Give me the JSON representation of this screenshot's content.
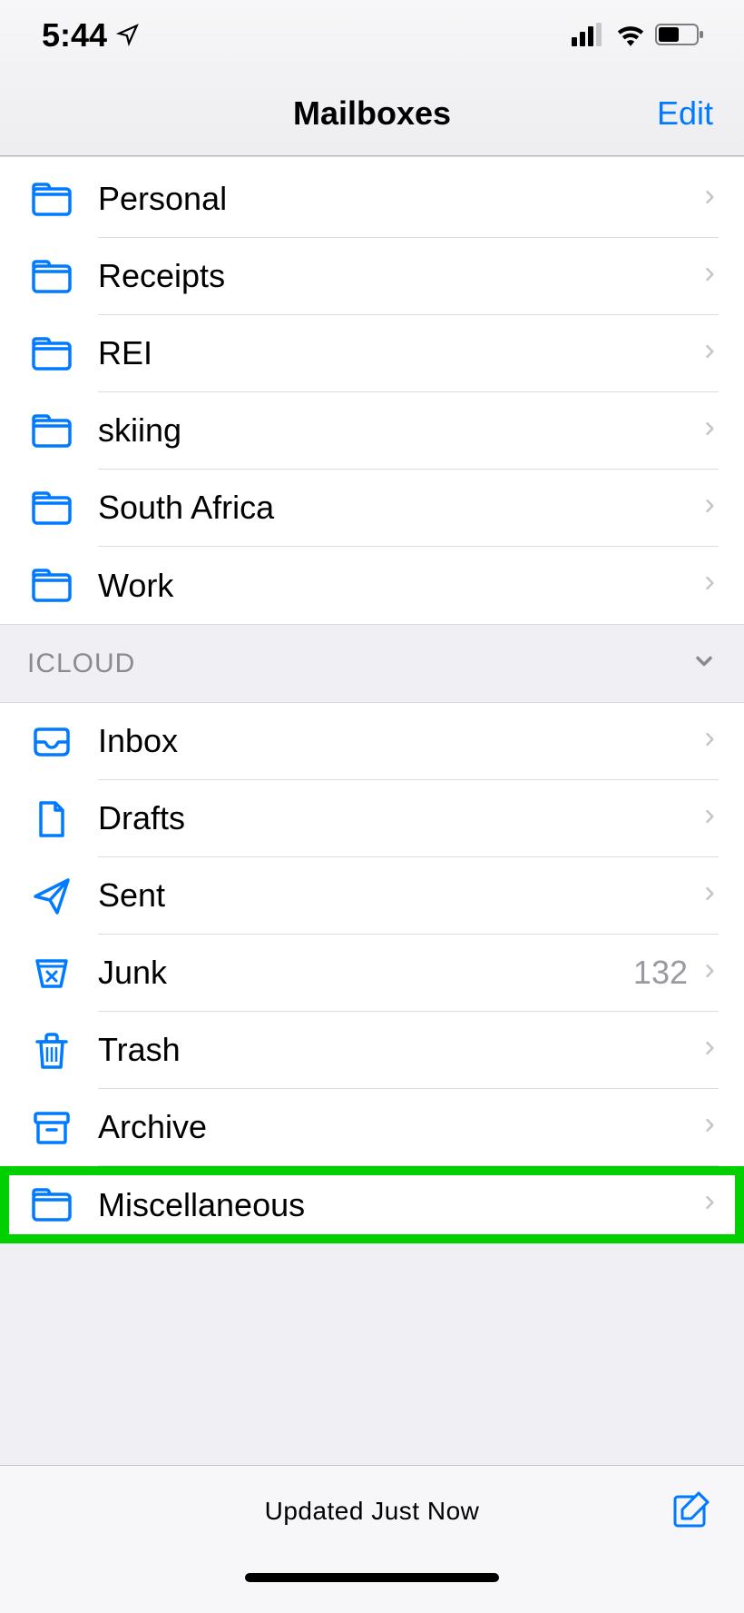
{
  "status": {
    "time": "5:44"
  },
  "header": {
    "title": "Mailboxes",
    "edit": "Edit"
  },
  "folders": [
    {
      "label": "Personal",
      "icon": "folder"
    },
    {
      "label": "Receipts",
      "icon": "folder"
    },
    {
      "label": "REI",
      "icon": "folder"
    },
    {
      "label": "skiing",
      "icon": "folder"
    },
    {
      "label": "South Africa",
      "icon": "folder"
    },
    {
      "label": "Work",
      "icon": "folder"
    }
  ],
  "section": {
    "title": "ICLOUD"
  },
  "icloud": [
    {
      "label": "Inbox",
      "icon": "inbox",
      "count": ""
    },
    {
      "label": "Drafts",
      "icon": "drafts",
      "count": ""
    },
    {
      "label": "Sent",
      "icon": "sent",
      "count": ""
    },
    {
      "label": "Junk",
      "icon": "junk",
      "count": "132"
    },
    {
      "label": "Trash",
      "icon": "trash",
      "count": ""
    },
    {
      "label": "Archive",
      "icon": "archive",
      "count": ""
    },
    {
      "label": "Miscellaneous",
      "icon": "folder",
      "count": "",
      "highlight": true
    }
  ],
  "toolbar": {
    "status": "Updated Just Now"
  }
}
